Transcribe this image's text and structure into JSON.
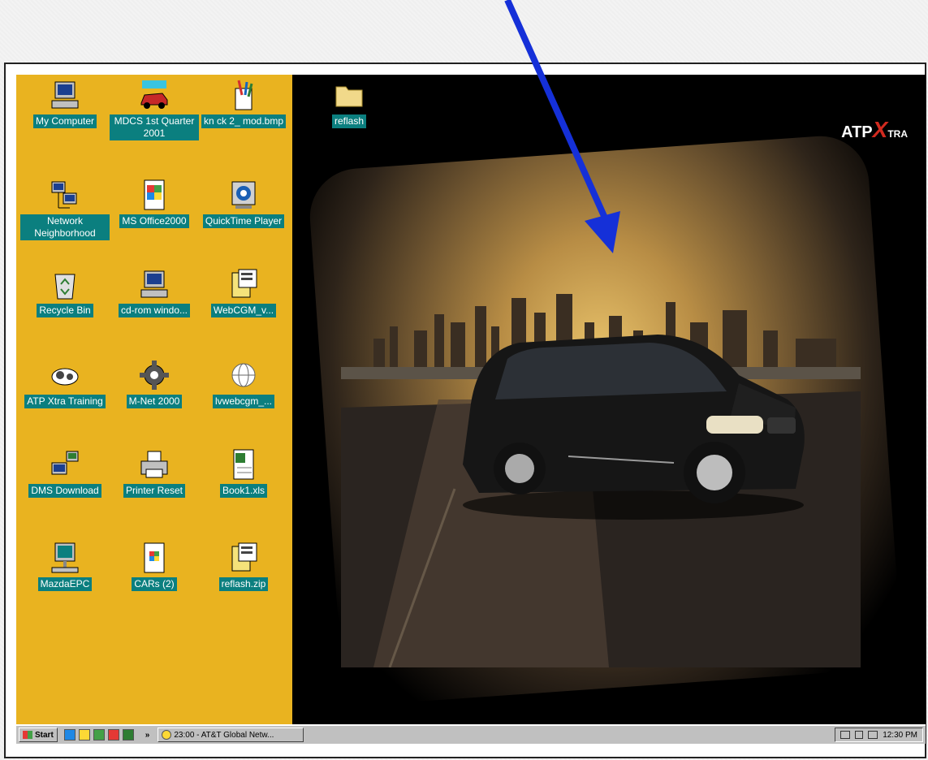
{
  "brand": {
    "prefix": "ATP",
    "x": "X",
    "suffix": "TRA"
  },
  "desktop_icons": [
    {
      "label": "My Computer",
      "icon": "computer-icon"
    },
    {
      "label": "MDCS 1st Quarter 2001",
      "icon": "mdcs-car-icon"
    },
    {
      "label": "kn ck 2_ mod.bmp",
      "icon": "paint-bitmap-icon"
    },
    {
      "label": "reflash",
      "icon": "folder-icon"
    },
    {
      "label": "Network Neighborhood",
      "icon": "network-icon"
    },
    {
      "label": "MS Office2000",
      "icon": "office-icon"
    },
    {
      "label": "QuickTime Player",
      "icon": "quicktime-icon"
    },
    {
      "label": "Recycle Bin",
      "icon": "recycle-bin-icon"
    },
    {
      "label": "cd-rom windo...",
      "icon": "cdrom-computer-icon"
    },
    {
      "label": "WebCGM_v...",
      "icon": "archive-icon"
    },
    {
      "label": "ATP Xtra Training",
      "icon": "training-icon"
    },
    {
      "label": "M-Net 2000",
      "icon": "gear-icon"
    },
    {
      "label": "lvwebcgm_...",
      "icon": "globe-icon"
    },
    {
      "label": "DMS Download",
      "icon": "network-download-icon"
    },
    {
      "label": "Printer Reset",
      "icon": "printer-icon"
    },
    {
      "label": "Book1.xls",
      "icon": "excel-icon"
    },
    {
      "label": "MazdaEPC",
      "icon": "terminal-icon"
    },
    {
      "label": "CARs (2)",
      "icon": "document-icon"
    },
    {
      "label": "reflash.zip",
      "icon": "zip-archive-icon"
    }
  ],
  "taskbar": {
    "start_label": "Start",
    "chevron": "»",
    "task_label": "23:00 - AT&T Global Netw...",
    "clock": "12:30 PM"
  },
  "colors": {
    "left_panel": "#e9b320",
    "icon_label_bg": "#0b7f7f",
    "arrow": "#1530d8",
    "brand_x": "#d12a1f"
  }
}
